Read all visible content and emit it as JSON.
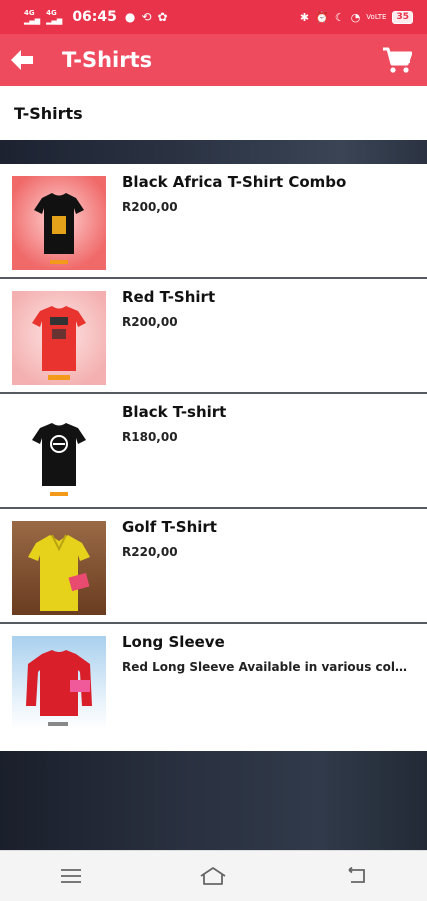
{
  "status_bar": {
    "signal_1": "4G",
    "signal_2": "4G",
    "time": "06:45",
    "battery": "35",
    "network_label": "VoLTE"
  },
  "toolbar": {
    "title": "T-Shirts",
    "back_icon": "arrow-left-icon",
    "cart_icon": "cart-icon"
  },
  "subheader": {
    "title": "T-Shirts"
  },
  "products": [
    {
      "name": "Black Africa T-Shirt Combo",
      "detail": "R200,00",
      "thumb_bg": "#f06a6a",
      "shirt_color": "#111111"
    },
    {
      "name": "Red T-Shirt",
      "detail": "R200,00",
      "thumb_bg": "#f7c0c0",
      "shirt_color": "#e8332f"
    },
    {
      "name": "Black T-shirt",
      "detail": "R180,00",
      "thumb_bg": "#ffffff",
      "shirt_color": "#121212"
    },
    {
      "name": "Golf T-Shirt",
      "detail": "R220,00",
      "thumb_bg": "#7a4a2a",
      "shirt_color": "#e6d21a"
    },
    {
      "name": "Long Sleeve",
      "detail": "Red Long Sleeve Available in various colou...",
      "thumb_bg": "#bcd9ee",
      "shirt_color": "#d81f2a"
    }
  ],
  "colors": {
    "status_bar": "#e8334a",
    "toolbar": "#ef4b5f"
  }
}
